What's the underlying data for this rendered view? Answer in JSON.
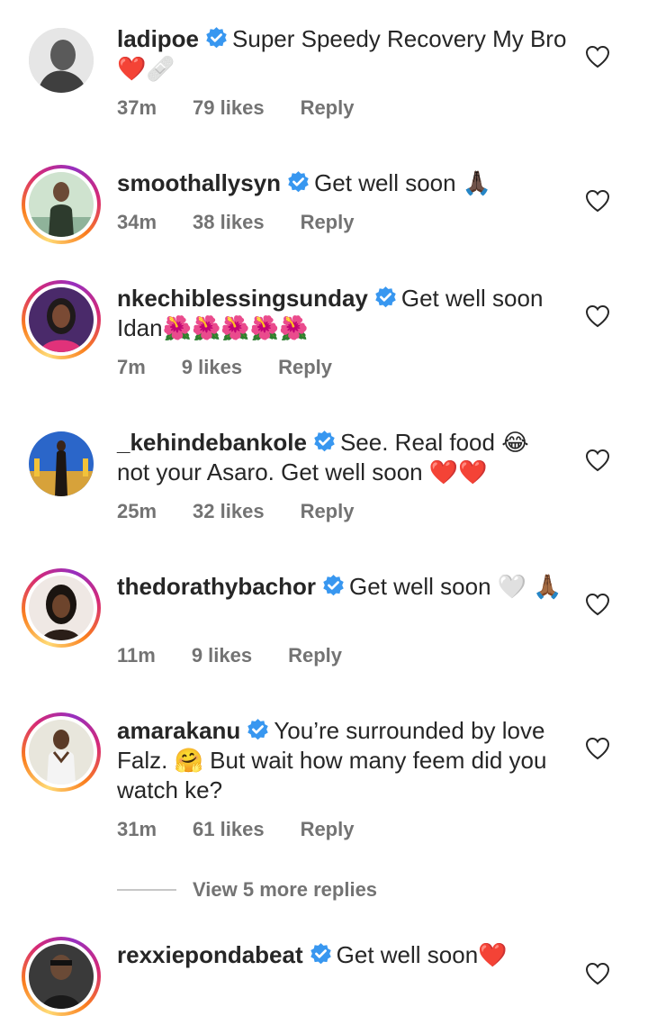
{
  "comments": [
    {
      "username": "ladipoe",
      "text": "Super Speedy Recovery My Bro ❤️🩹",
      "time": "37m",
      "likes": "79 likes",
      "reply": "Reply",
      "avatar_ring": false
    },
    {
      "username": "smoothallysyn",
      "text": "Get well soon 🙏🏿",
      "time": "34m",
      "likes": "38 likes",
      "reply": "Reply",
      "avatar_ring": true
    },
    {
      "username": "nkechiblessingsunday",
      "text": "Get well soon Idan🌺🌺🌺🌺🌺",
      "time": "7m",
      "likes": "9 likes",
      "reply": "Reply",
      "avatar_ring": true
    },
    {
      "username": "_kehindebankole",
      "text": "See. Real food 😂 not your Asaro. Get well soon ❤️❤️",
      "time": "25m",
      "likes": "32 likes",
      "reply": "Reply",
      "avatar_ring": false
    },
    {
      "username": "thedorathybachor",
      "text": "Get well soon 🤍 🙏🏾",
      "time": "11m",
      "likes": "9 likes",
      "reply": "Reply",
      "avatar_ring": true
    },
    {
      "username": "amarakanu",
      "text": "You’re surrounded by love Falz. 🤗 But wait how many feem did you watch ke?",
      "time": "31m",
      "likes": "61 likes",
      "reply": "Reply",
      "avatar_ring": true
    },
    {
      "username": "rexxiepondabeat",
      "text": "Get well soon❤️",
      "avatar_ring": true
    }
  ],
  "view_more_replies": "View 5 more replies",
  "colors": {
    "text": "#262626",
    "meta": "#737373",
    "verified": "#3897f0"
  },
  "icons": {
    "verified": "verified-badge-icon",
    "like": "heart-outline-icon"
  }
}
